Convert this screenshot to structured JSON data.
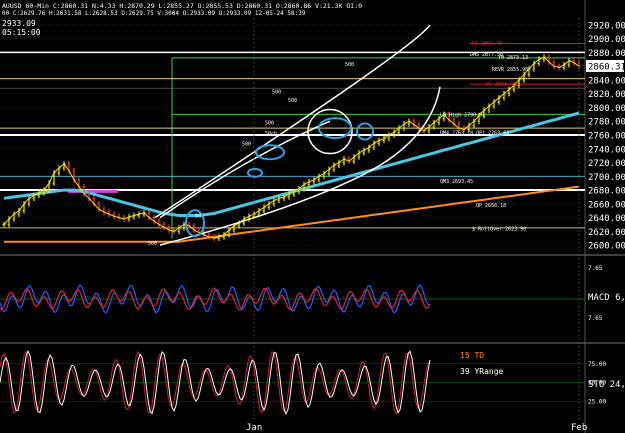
{
  "header": {
    "line1": "AUUSD 60-Min C:2860.31 N:4.33 H:2870.29 L:2855.27 O:2855.53 D:2860.31 O:2860.86 V:21.3K OI:0",
    "line2": "00 C:2629.76 H:2631.58 L:2628.53 O:2629.75 V:3004 O:2933.09 O:2933.09 12-05-24 58:39",
    "cursor_price": "2933.09",
    "cursor_time": "05:15:00"
  },
  "colors": {
    "price_up": "#f5e400",
    "price_down": "#ff3b30",
    "ma_cyan": "#49c6e5",
    "ma_yellow": "#f0e000",
    "ma_orange": "#ff8c1a",
    "ma_tan": "#c8b476",
    "grid": "#3a3a3a",
    "macd": "#2a5bff",
    "signal": "#e0262b",
    "sto_k": "#ffffff",
    "sto_d": "#d02020",
    "annotation_white": "#ffffff",
    "annotation_blue": "#2fa3e8",
    "green_level": "#37d437"
  },
  "chart_data": [
    {
      "type": "line",
      "panel": "price",
      "ylim": [
        2590,
        2930
      ],
      "y_ticks": [
        "2920.00",
        "2900.00",
        "2880.00",
        "2860.31",
        "2840.00",
        "2820.00",
        "2800.00",
        "2780.00",
        "2760.00",
        "2740.00",
        "2720.00",
        "2700.00",
        "2680.00",
        "2660.00",
        "2640.00",
        "2620.00",
        "2600.00"
      ],
      "y_tick_values": [
        2920,
        2900,
        2880,
        2860.31,
        2840,
        2820,
        2800,
        2780,
        2760,
        2740,
        2720,
        2700,
        2680,
        2660,
        2640,
        2620,
        2600
      ],
      "last_price": "2860.31",
      "x_ticks": [
        "Jan",
        "Feb"
      ],
      "x_tick_positions_idx": [
        50,
        115
      ],
      "series": [
        {
          "values": [
            2630,
            2638,
            2645,
            2650,
            2660,
            2668,
            2672,
            2676,
            2680,
            2690,
            2705,
            2712,
            2718,
            2708,
            2695,
            2685,
            2675,
            2668,
            2660,
            2652,
            2648,
            2645,
            2642,
            2640,
            2638,
            2641,
            2643,
            2645,
            2647,
            2640,
            2635,
            2630,
            2626,
            2622,
            2620,
            2625,
            2630,
            2628,
            2622,
            2618,
            2615,
            2612,
            2610,
            2612,
            2615,
            2622,
            2628,
            2632,
            2638,
            2642,
            2645,
            2650,
            2655,
            2660,
            2665,
            2668,
            2670,
            2674,
            2678,
            2682,
            2688,
            2692,
            2695,
            2700,
            2704,
            2710,
            2716,
            2720,
            2725,
            2722,
            2728,
            2734,
            2738,
            2742,
            2748,
            2752,
            2755,
            2760,
            2764,
            2770,
            2776,
            2780,
            2775,
            2770,
            2766,
            2772,
            2778,
            2784,
            2790,
            2782,
            2776,
            2770,
            2768,
            2774,
            2780,
            2788,
            2796,
            2802,
            2808,
            2814,
            2820,
            2826,
            2832,
            2840,
            2848,
            2856,
            2864,
            2870,
            2873,
            2866,
            2860,
            2858,
            2862,
            2868,
            2865,
            2860
          ]
        },
        {
          "name": "",
          "role": "ma_cyan",
          "values": [
            2668,
            2669,
            2670,
            2671,
            2672,
            2673,
            2674,
            2675,
            2676,
            2677,
            2678,
            2679,
            2680,
            2680,
            2680,
            2679,
            2678,
            2676,
            2674,
            2672,
            2670,
            2668,
            2666,
            2664,
            2662,
            2660,
            2658,
            2656,
            2654,
            2652,
            2650,
            2648,
            2646,
            2645,
            2644,
            2643,
            2643,
            2643,
            2643,
            2643,
            2644,
            2645,
            2646,
            2648,
            2650,
            2652,
            2654,
            2656,
            2658,
            2660,
            2662,
            2664,
            2666,
            2668,
            2670,
            2672,
            2674,
            2676,
            2678,
            2680,
            2682,
            2684,
            2686,
            2688,
            2690,
            2692,
            2694,
            2696,
            2698,
            2700,
            2702,
            2704,
            2706,
            2708,
            2710,
            2712,
            2714,
            2716,
            2718,
            2720,
            2722,
            2724,
            2726,
            2728,
            2730,
            2732,
            2734,
            2736,
            2738,
            2740,
            2742,
            2744,
            2746,
            2748,
            2750,
            2752,
            2754,
            2756,
            2758,
            2760,
            2762,
            2764,
            2766,
            2768,
            2770,
            2772,
            2774,
            2776,
            2778,
            2780,
            2782,
            2784,
            2786,
            2788,
            2790,
            2792
          ]
        },
        {
          "name": "",
          "role": "ma_orange",
          "values": [
            2605,
            2605,
            2605,
            2605,
            2605,
            2605,
            2605,
            2605,
            2605,
            2605,
            2605,
            2605,
            2605,
            2605,
            2605,
            2605,
            2605,
            2605,
            2605,
            2605,
            2605,
            2605,
            2605,
            2605,
            2605,
            2605,
            2605,
            2605,
            2605,
            2605,
            2605,
            2605,
            2605,
            2605,
            2605,
            2605,
            2606,
            2607,
            2608,
            2609,
            2610,
            2611,
            2612,
            2613,
            2614,
            2615,
            2616,
            2617,
            2618,
            2619,
            2620,
            2621,
            2622,
            2623,
            2624,
            2625,
            2626,
            2627,
            2628,
            2629,
            2630,
            2631,
            2632,
            2633,
            2634,
            2635,
            2636,
            2637,
            2638,
            2639,
            2640,
            2641,
            2642,
            2643,
            2644,
            2645,
            2646,
            2647,
            2648,
            2649,
            2650,
            2651,
            2652,
            2653,
            2654,
            2655,
            2656,
            2657,
            2658,
            2659,
            2660,
            2661,
            2662,
            2663,
            2664,
            2665,
            2666,
            2667,
            2668,
            2669,
            2670,
            2671,
            2672,
            2673,
            2674,
            2675,
            2676,
            2677,
            2678,
            2679,
            2680,
            2681,
            2682,
            2683,
            2684,
            2685
          ]
        }
      ],
      "annotations": [
        {
          "text": "R1 2893.46",
          "price": 2893.46
        },
        {
          "text": "DMS 2877.50",
          "price": 2877.5
        },
        {
          "text": "YH 2873.13",
          "price": 2873.13
        },
        {
          "text": "REVR 2855.98",
          "price": 2855.98
        },
        {
          "text": "YL 2834.06",
          "price": 2834.06
        },
        {
          "text": "LB High 2790.01",
          "price": 2790.01
        },
        {
          "text": "DM4 2763.18  OP1 2763.63",
          "price": 2763.4
        },
        {
          "text": "QM3 2693.45",
          "price": 2693.45
        },
        {
          "text": "QP 2658.18",
          "price": 2658.18
        },
        {
          "text": "$ RollOver 2623.90",
          "price": 2623.9
        }
      ],
      "volume_profile_labels": [
        "500",
        "500",
        "500",
        "500",
        "50ch",
        "500",
        "500",
        "500"
      ]
    },
    {
      "type": "line",
      "panel": "macd",
      "title": "MACD 6,",
      "ylim": [
        -10,
        10
      ],
      "y_ticks": [
        "7.65",
        "7.65"
      ],
      "series": [
        {
          "role": "macd"
        },
        {
          "role": "signal"
        }
      ]
    },
    {
      "type": "line",
      "panel": "stochastic",
      "title": "STO 24,",
      "ylim": [
        0,
        100
      ],
      "y_ticks": [
        "75.00",
        "50.00",
        "25.00"
      ],
      "y_tick_values": [
        75,
        50,
        25
      ],
      "labels": [
        "15 TD",
        "39 YRange"
      ]
    }
  ]
}
